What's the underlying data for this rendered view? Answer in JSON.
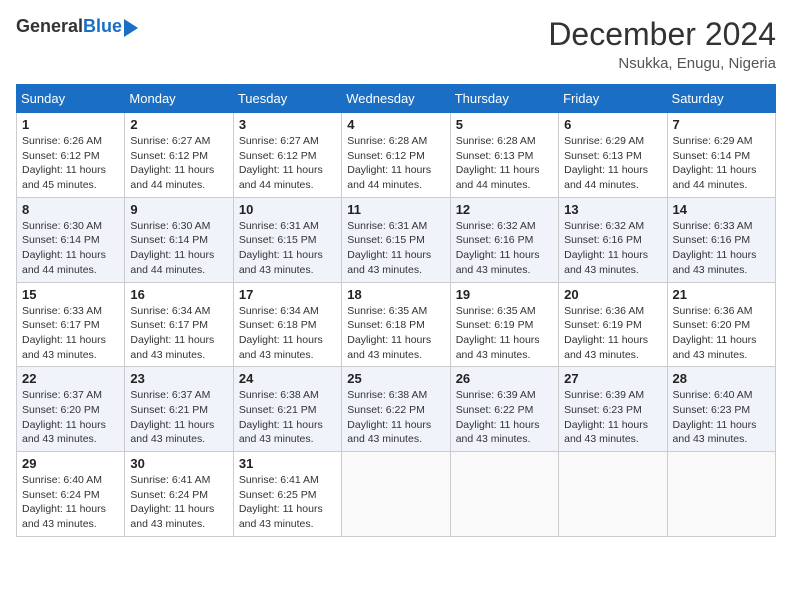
{
  "header": {
    "logo_general": "General",
    "logo_blue": "Blue",
    "month_year": "December 2024",
    "location": "Nsukka, Enugu, Nigeria"
  },
  "days_of_week": [
    "Sunday",
    "Monday",
    "Tuesday",
    "Wednesday",
    "Thursday",
    "Friday",
    "Saturday"
  ],
  "weeks": [
    [
      {
        "day": "1",
        "sunrise": "6:26 AM",
        "sunset": "6:12 PM",
        "daylight": "11 hours and 45 minutes."
      },
      {
        "day": "2",
        "sunrise": "6:27 AM",
        "sunset": "6:12 PM",
        "daylight": "11 hours and 44 minutes."
      },
      {
        "day": "3",
        "sunrise": "6:27 AM",
        "sunset": "6:12 PM",
        "daylight": "11 hours and 44 minutes."
      },
      {
        "day": "4",
        "sunrise": "6:28 AM",
        "sunset": "6:12 PM",
        "daylight": "11 hours and 44 minutes."
      },
      {
        "day": "5",
        "sunrise": "6:28 AM",
        "sunset": "6:13 PM",
        "daylight": "11 hours and 44 minutes."
      },
      {
        "day": "6",
        "sunrise": "6:29 AM",
        "sunset": "6:13 PM",
        "daylight": "11 hours and 44 minutes."
      },
      {
        "day": "7",
        "sunrise": "6:29 AM",
        "sunset": "6:14 PM",
        "daylight": "11 hours and 44 minutes."
      }
    ],
    [
      {
        "day": "8",
        "sunrise": "6:30 AM",
        "sunset": "6:14 PM",
        "daylight": "11 hours and 44 minutes."
      },
      {
        "day": "9",
        "sunrise": "6:30 AM",
        "sunset": "6:14 PM",
        "daylight": "11 hours and 44 minutes."
      },
      {
        "day": "10",
        "sunrise": "6:31 AM",
        "sunset": "6:15 PM",
        "daylight": "11 hours and 43 minutes."
      },
      {
        "day": "11",
        "sunrise": "6:31 AM",
        "sunset": "6:15 PM",
        "daylight": "11 hours and 43 minutes."
      },
      {
        "day": "12",
        "sunrise": "6:32 AM",
        "sunset": "6:16 PM",
        "daylight": "11 hours and 43 minutes."
      },
      {
        "day": "13",
        "sunrise": "6:32 AM",
        "sunset": "6:16 PM",
        "daylight": "11 hours and 43 minutes."
      },
      {
        "day": "14",
        "sunrise": "6:33 AM",
        "sunset": "6:16 PM",
        "daylight": "11 hours and 43 minutes."
      }
    ],
    [
      {
        "day": "15",
        "sunrise": "6:33 AM",
        "sunset": "6:17 PM",
        "daylight": "11 hours and 43 minutes."
      },
      {
        "day": "16",
        "sunrise": "6:34 AM",
        "sunset": "6:17 PM",
        "daylight": "11 hours and 43 minutes."
      },
      {
        "day": "17",
        "sunrise": "6:34 AM",
        "sunset": "6:18 PM",
        "daylight": "11 hours and 43 minutes."
      },
      {
        "day": "18",
        "sunrise": "6:35 AM",
        "sunset": "6:18 PM",
        "daylight": "11 hours and 43 minutes."
      },
      {
        "day": "19",
        "sunrise": "6:35 AM",
        "sunset": "6:19 PM",
        "daylight": "11 hours and 43 minutes."
      },
      {
        "day": "20",
        "sunrise": "6:36 AM",
        "sunset": "6:19 PM",
        "daylight": "11 hours and 43 minutes."
      },
      {
        "day": "21",
        "sunrise": "6:36 AM",
        "sunset": "6:20 PM",
        "daylight": "11 hours and 43 minutes."
      }
    ],
    [
      {
        "day": "22",
        "sunrise": "6:37 AM",
        "sunset": "6:20 PM",
        "daylight": "11 hours and 43 minutes."
      },
      {
        "day": "23",
        "sunrise": "6:37 AM",
        "sunset": "6:21 PM",
        "daylight": "11 hours and 43 minutes."
      },
      {
        "day": "24",
        "sunrise": "6:38 AM",
        "sunset": "6:21 PM",
        "daylight": "11 hours and 43 minutes."
      },
      {
        "day": "25",
        "sunrise": "6:38 AM",
        "sunset": "6:22 PM",
        "daylight": "11 hours and 43 minutes."
      },
      {
        "day": "26",
        "sunrise": "6:39 AM",
        "sunset": "6:22 PM",
        "daylight": "11 hours and 43 minutes."
      },
      {
        "day": "27",
        "sunrise": "6:39 AM",
        "sunset": "6:23 PM",
        "daylight": "11 hours and 43 minutes."
      },
      {
        "day": "28",
        "sunrise": "6:40 AM",
        "sunset": "6:23 PM",
        "daylight": "11 hours and 43 minutes."
      }
    ],
    [
      {
        "day": "29",
        "sunrise": "6:40 AM",
        "sunset": "6:24 PM",
        "daylight": "11 hours and 43 minutes."
      },
      {
        "day": "30",
        "sunrise": "6:41 AM",
        "sunset": "6:24 PM",
        "daylight": "11 hours and 43 minutes."
      },
      {
        "day": "31",
        "sunrise": "6:41 AM",
        "sunset": "6:25 PM",
        "daylight": "11 hours and 43 minutes."
      },
      null,
      null,
      null,
      null
    ]
  ],
  "labels": {
    "sunrise": "Sunrise: ",
    "sunset": "Sunset: ",
    "daylight": "Daylight: "
  }
}
